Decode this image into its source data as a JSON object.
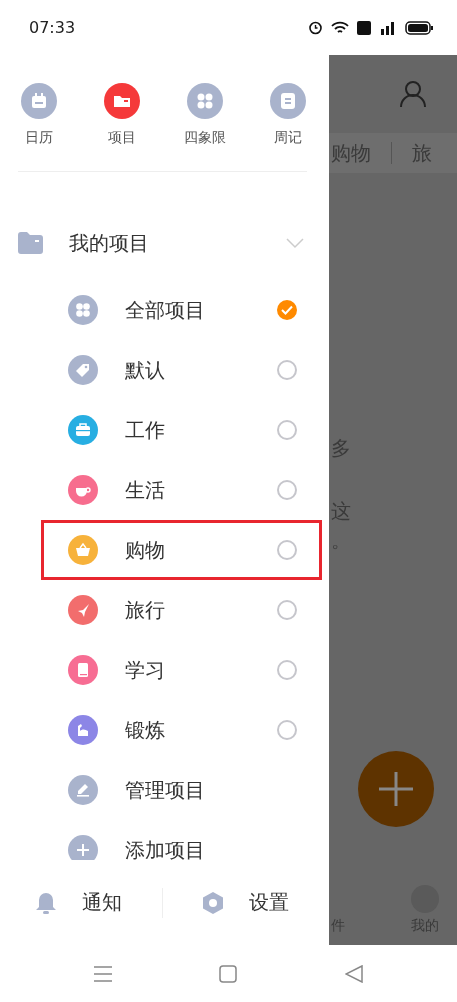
{
  "status_bar": {
    "time": "07:33"
  },
  "shortcuts": [
    {
      "label": "日历",
      "selected": false
    },
    {
      "label": "项目",
      "selected": true
    },
    {
      "label": "四象限",
      "selected": false
    },
    {
      "label": "周记",
      "selected": false
    }
  ],
  "project_group": {
    "title": "我的项目",
    "expanded": true,
    "items": [
      {
        "kind": "project",
        "label": "全部项目",
        "color": "#a9b3cc",
        "checked": true,
        "highlighted": false
      },
      {
        "kind": "project",
        "label": "默认",
        "color": "#a9b3cc",
        "checked": false,
        "highlighted": false
      },
      {
        "kind": "project",
        "label": "工作",
        "color": "#27aee2",
        "checked": false,
        "highlighted": false
      },
      {
        "kind": "project",
        "label": "生活",
        "color": "#f76d8e",
        "checked": false,
        "highlighted": false
      },
      {
        "kind": "project",
        "label": "购物",
        "color": "#f7b23b",
        "checked": false,
        "highlighted": true
      },
      {
        "kind": "project",
        "label": "旅行",
        "color": "#f26d6d",
        "checked": false,
        "highlighted": false
      },
      {
        "kind": "project",
        "label": "学习",
        "color": "#f76d93",
        "checked": false,
        "highlighted": false
      },
      {
        "kind": "project",
        "label": "锻炼",
        "color": "#8c86e6",
        "checked": false,
        "highlighted": false
      },
      {
        "kind": "action",
        "label": "管理项目",
        "color": "#a9b3cc"
      },
      {
        "kind": "action",
        "label": "添加项目",
        "color": "#a9b3cc"
      }
    ]
  },
  "footer": [
    {
      "label": "通知"
    },
    {
      "label": "设置"
    }
  ],
  "background": {
    "tabs": [
      "购物",
      "旅"
    ],
    "texts": [
      "多",
      "这",
      "。"
    ],
    "nav_labels": [
      "件",
      "我的"
    ]
  }
}
